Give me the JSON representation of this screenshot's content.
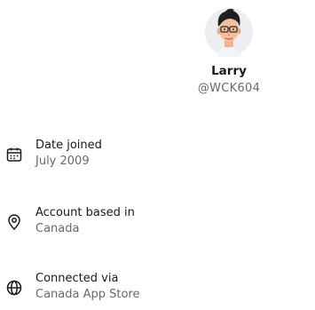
{
  "profile": {
    "name": "Larry",
    "handle": "@WCK604",
    "avatar_icon": "cartoon-man-avatar"
  },
  "details": [
    {
      "icon": "calendar-icon",
      "label": "Date joined",
      "value": "July 2009"
    },
    {
      "icon": "location-pin-icon",
      "label": "Account based in",
      "value": "Canada"
    },
    {
      "icon": "globe-icon",
      "label": "Connected via",
      "value": "Canada App Store"
    }
  ],
  "colors": {
    "primary_text": "#1a1a1a",
    "secondary_text": "#666a70"
  }
}
